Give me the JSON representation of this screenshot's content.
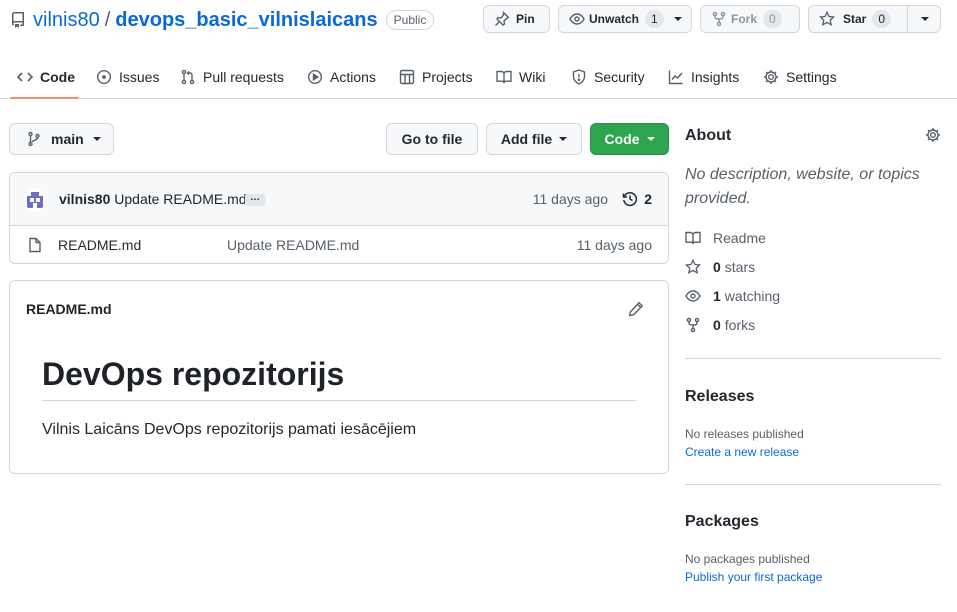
{
  "repo": {
    "owner": "vilnis80",
    "separator": "/",
    "name": "devops_basic_vilnislaicans",
    "visibility": "Public"
  },
  "actions": {
    "pin_label": "Pin",
    "unwatch_label": "Unwatch",
    "watch_count": "1",
    "fork_label": "Fork",
    "fork_count": "0",
    "star_label": "Star",
    "star_count": "0"
  },
  "nav": {
    "tabs": [
      {
        "label": "Code",
        "icon": "code-icon",
        "active": true
      },
      {
        "label": "Issues",
        "icon": "issue-icon"
      },
      {
        "label": "Pull requests",
        "icon": "pull-request-icon"
      },
      {
        "label": "Actions",
        "icon": "play-icon"
      },
      {
        "label": "Projects",
        "icon": "table-icon"
      },
      {
        "label": "Wiki",
        "icon": "book-icon"
      },
      {
        "label": "Security",
        "icon": "shield-icon"
      },
      {
        "label": "Insights",
        "icon": "graph-icon"
      },
      {
        "label": "Settings",
        "icon": "gear-icon"
      }
    ]
  },
  "toolbar": {
    "branch": "main",
    "go_to_file": "Go to file",
    "add_file": "Add file",
    "code": "Code"
  },
  "commit": {
    "author": "vilnis80",
    "message": "Update README.md",
    "ellipsis": "…",
    "time": "11 days ago",
    "count": "2"
  },
  "files": [
    {
      "name": "README.md",
      "message": "Update README.md",
      "time": "11 days ago"
    }
  ],
  "readme": {
    "filename": "README.md",
    "heading": "DevOps repozitorijs",
    "paragraph": "Vilnis Laicāns DevOps repozitorijs pamati iesācējiem"
  },
  "about": {
    "title": "About",
    "description": "No description, website, or topics provided.",
    "readme_label": "Readme",
    "stars_count": "0",
    "stars_label": "stars",
    "watching_count": "1",
    "watching_label": "watching",
    "forks_count": "0",
    "forks_label": "forks"
  },
  "releases": {
    "title": "Releases",
    "empty": "No releases published",
    "link": "Create a new release"
  },
  "packages": {
    "title": "Packages",
    "empty": "No packages published",
    "link": "Publish your first package"
  },
  "colors": {
    "link": "#0969da",
    "primary_button": "#2da44e",
    "active_tab_underline": "#fd8c73",
    "border": "#d0d7de"
  }
}
